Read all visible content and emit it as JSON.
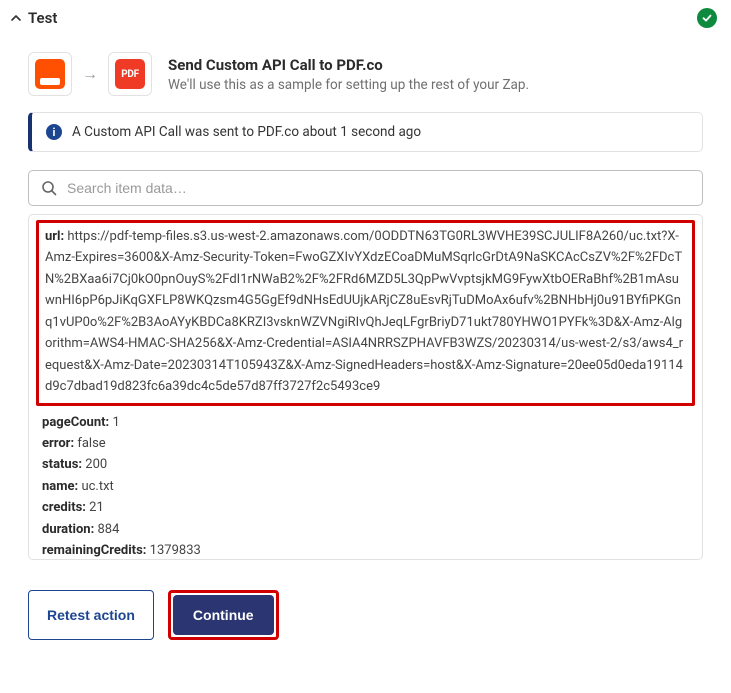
{
  "header": {
    "title": "Test"
  },
  "step": {
    "pdf_label": "PDF",
    "title": "Send Custom API Call to PDF.co",
    "subtitle": "We'll use this as a sample for setting up the rest of your Zap."
  },
  "banner": {
    "text": "A Custom API Call was sent to PDF.co about 1 second ago"
  },
  "search": {
    "placeholder": "Search item data…"
  },
  "result": {
    "url_key": "url:",
    "url_value": "https://pdf-temp-files.s3.us-west-2.amazonaws.com/0ODDTN63TG0RL3WVHE39SCJULIF8A260/uc.txt?X-Amz-Expires=3600&X-Amz-Security-Token=FwoGZXIvYXdzECoaDMuMSqrlcGrDtA9NaSKCAcCsZV%2F%2FDcTN%2BXaa6i7Cj0kO0pnOuyS%2FdI1rNWaB2%2F%2FRd6MZD5L3QpPwVvptsjkMG9FywXtbOERaBhf%2B1mAsuwnHI6pP6pJiKqGXFLP8WKQzsm4G5GgEf9dNHsEdUUjkARjCZ8uEsvRjTuDMoAx6ufv%2BNHbHj0u91BYfiPKGnq1vUP0o%2F%2B3AoAYyKBDCa8KRZI3vsknWZVNgiRIvQhJeqLFgrBriyD71ukt780YHWO1PYFk%3D&X-Amz-Algorithm=AWS4-HMAC-SHA256&X-Amz-Credential=ASIA4NRRSZPHAVFB3WZS/20230314/us-west-2/s3/aws4_request&X-Amz-Date=20230314T105943Z&X-Amz-SignedHeaders=host&X-Amz-Signature=20ee05d0eda19114d9c7dbad19d823fc6a39dc4c5de57d87ff3727f2c5493ce9",
    "pageCount_key": "pageCount:",
    "pageCount_value": "1",
    "error_key": "error:",
    "error_value": "false",
    "status_key": "status:",
    "status_value": "200",
    "name_key": "name:",
    "name_value": "uc.txt",
    "credits_key": "credits:",
    "credits_value": "21",
    "duration_key": "duration:",
    "duration_value": "884",
    "remainingCredits_key": "remainingCredits:",
    "remainingCredits_value": "1379833"
  },
  "buttons": {
    "retest": "Retest action",
    "continue": "Continue"
  }
}
